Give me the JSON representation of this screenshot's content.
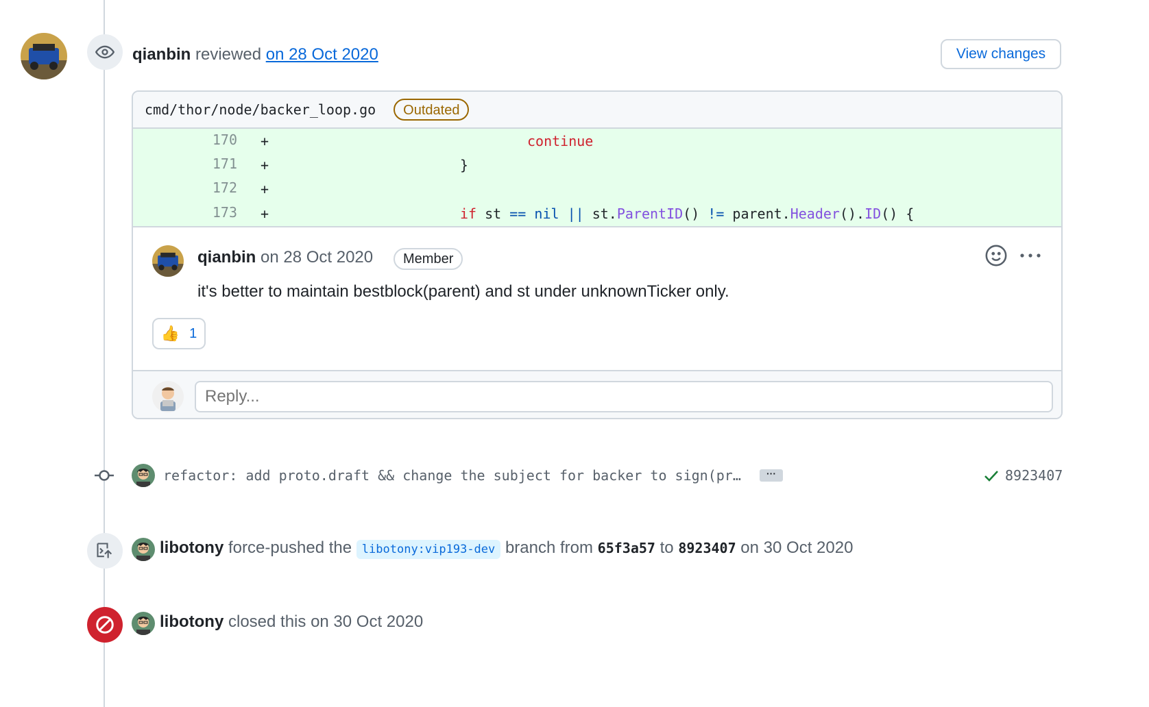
{
  "review": {
    "reviewer": "qianbin",
    "action": "reviewed",
    "date_link": "on 28 Oct 2020",
    "view_changes_label": "View changes"
  },
  "file": {
    "path": "cmd/thor/node/backer_loop.go",
    "badge": "Outdated"
  },
  "diff": {
    "lines": [
      {
        "num": "170",
        "sign": "+",
        "code": "continue"
      },
      {
        "num": "171",
        "sign": "+",
        "code": "}"
      },
      {
        "num": "172",
        "sign": "+",
        "code": ""
      },
      {
        "num": "173",
        "sign": "+",
        "code": "if st == nil || st.ParentID() != parent.Header().ID() {"
      }
    ],
    "tokens": {
      "kw_if": "if",
      "st": " st ",
      "eq": "==",
      "nil": " nil ",
      "or": "||",
      "st2": " st.",
      "parent_id": "ParentID",
      "parens": "() ",
      "neq": "!=",
      "parent": " parent.",
      "header": "Header",
      "dot": "().",
      "id": "ID",
      "end": "() {"
    }
  },
  "comment": {
    "author": "qianbin",
    "date": "on 28 Oct 2020",
    "role_badge": "Member",
    "body": "it's better to maintain bestblock(parent) and st under unknownTicker only.",
    "reaction_emoji": "👍",
    "reaction_count": "1"
  },
  "reply": {
    "placeholder": "Reply..."
  },
  "commit": {
    "message": "refactor: add proto.draft && change the subject for backer to sign(pr…",
    "ellipsis": "···",
    "sha": "8923407"
  },
  "force_push": {
    "actor": "libotony",
    "action": "force-pushed the",
    "branch": "libotony:vip193-dev",
    "branch_from": "branch from",
    "from_sha": "65f3a57",
    "to": "to",
    "to_sha": "8923407",
    "date": "on 30 Oct 2020"
  },
  "closed": {
    "actor": "libotony",
    "action": "closed this",
    "date": "on 30 Oct 2020"
  }
}
